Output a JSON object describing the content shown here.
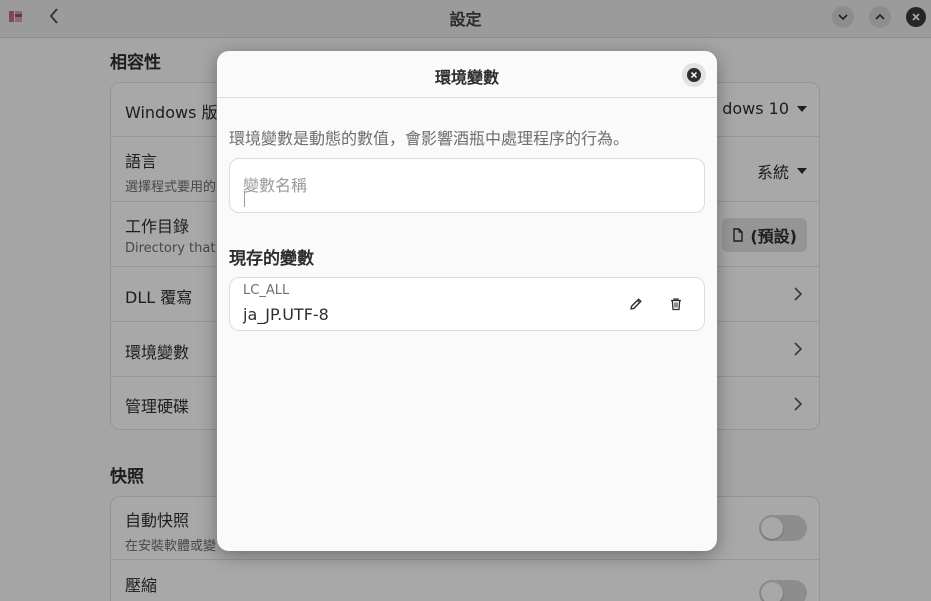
{
  "window": {
    "title": "設定"
  },
  "sections": {
    "compat": "相容性",
    "snapshots": "快照"
  },
  "compat_rows": {
    "windows": {
      "title": "Windows 版",
      "value": "dows 10"
    },
    "language": {
      "title": "語言",
      "subtitle": "選擇程式要用的",
      "value": "系統"
    },
    "workdir": {
      "title": "工作目錄",
      "subtitle": "Directory that",
      "button": "(預設)"
    },
    "dll": {
      "title": "DLL 覆寫"
    },
    "env": {
      "title": "環境變數"
    },
    "drives": {
      "title": "管理硬碟"
    }
  },
  "snapshot_rows": {
    "auto": {
      "title": "自動快照",
      "subtitle": "在安裝軟體或變"
    },
    "compress": {
      "title": "壓縮"
    }
  },
  "dialog": {
    "title": "環境變數",
    "description": "環境變數是動態的數值，會影響酒瓶中處理程序的行為。",
    "name_placeholder": "變數名稱",
    "name_value": "",
    "existing_title": "現存的變數",
    "variables": [
      {
        "key": "LC_ALL",
        "value": "ja_JP.UTF-8"
      }
    ]
  },
  "icons": {
    "back": "back-chevron-icon",
    "minimize": "chevron-down-icon",
    "maximize": "chevron-up-icon",
    "close": "close-icon",
    "edit": "pencil-icon",
    "delete": "trash-icon"
  },
  "colors": {
    "header_bg": "#ebebeb",
    "dialog_bg": "#fafafa",
    "card_bg": "#ffffff",
    "overlay": "rgba(0,0,0,0.34)"
  }
}
